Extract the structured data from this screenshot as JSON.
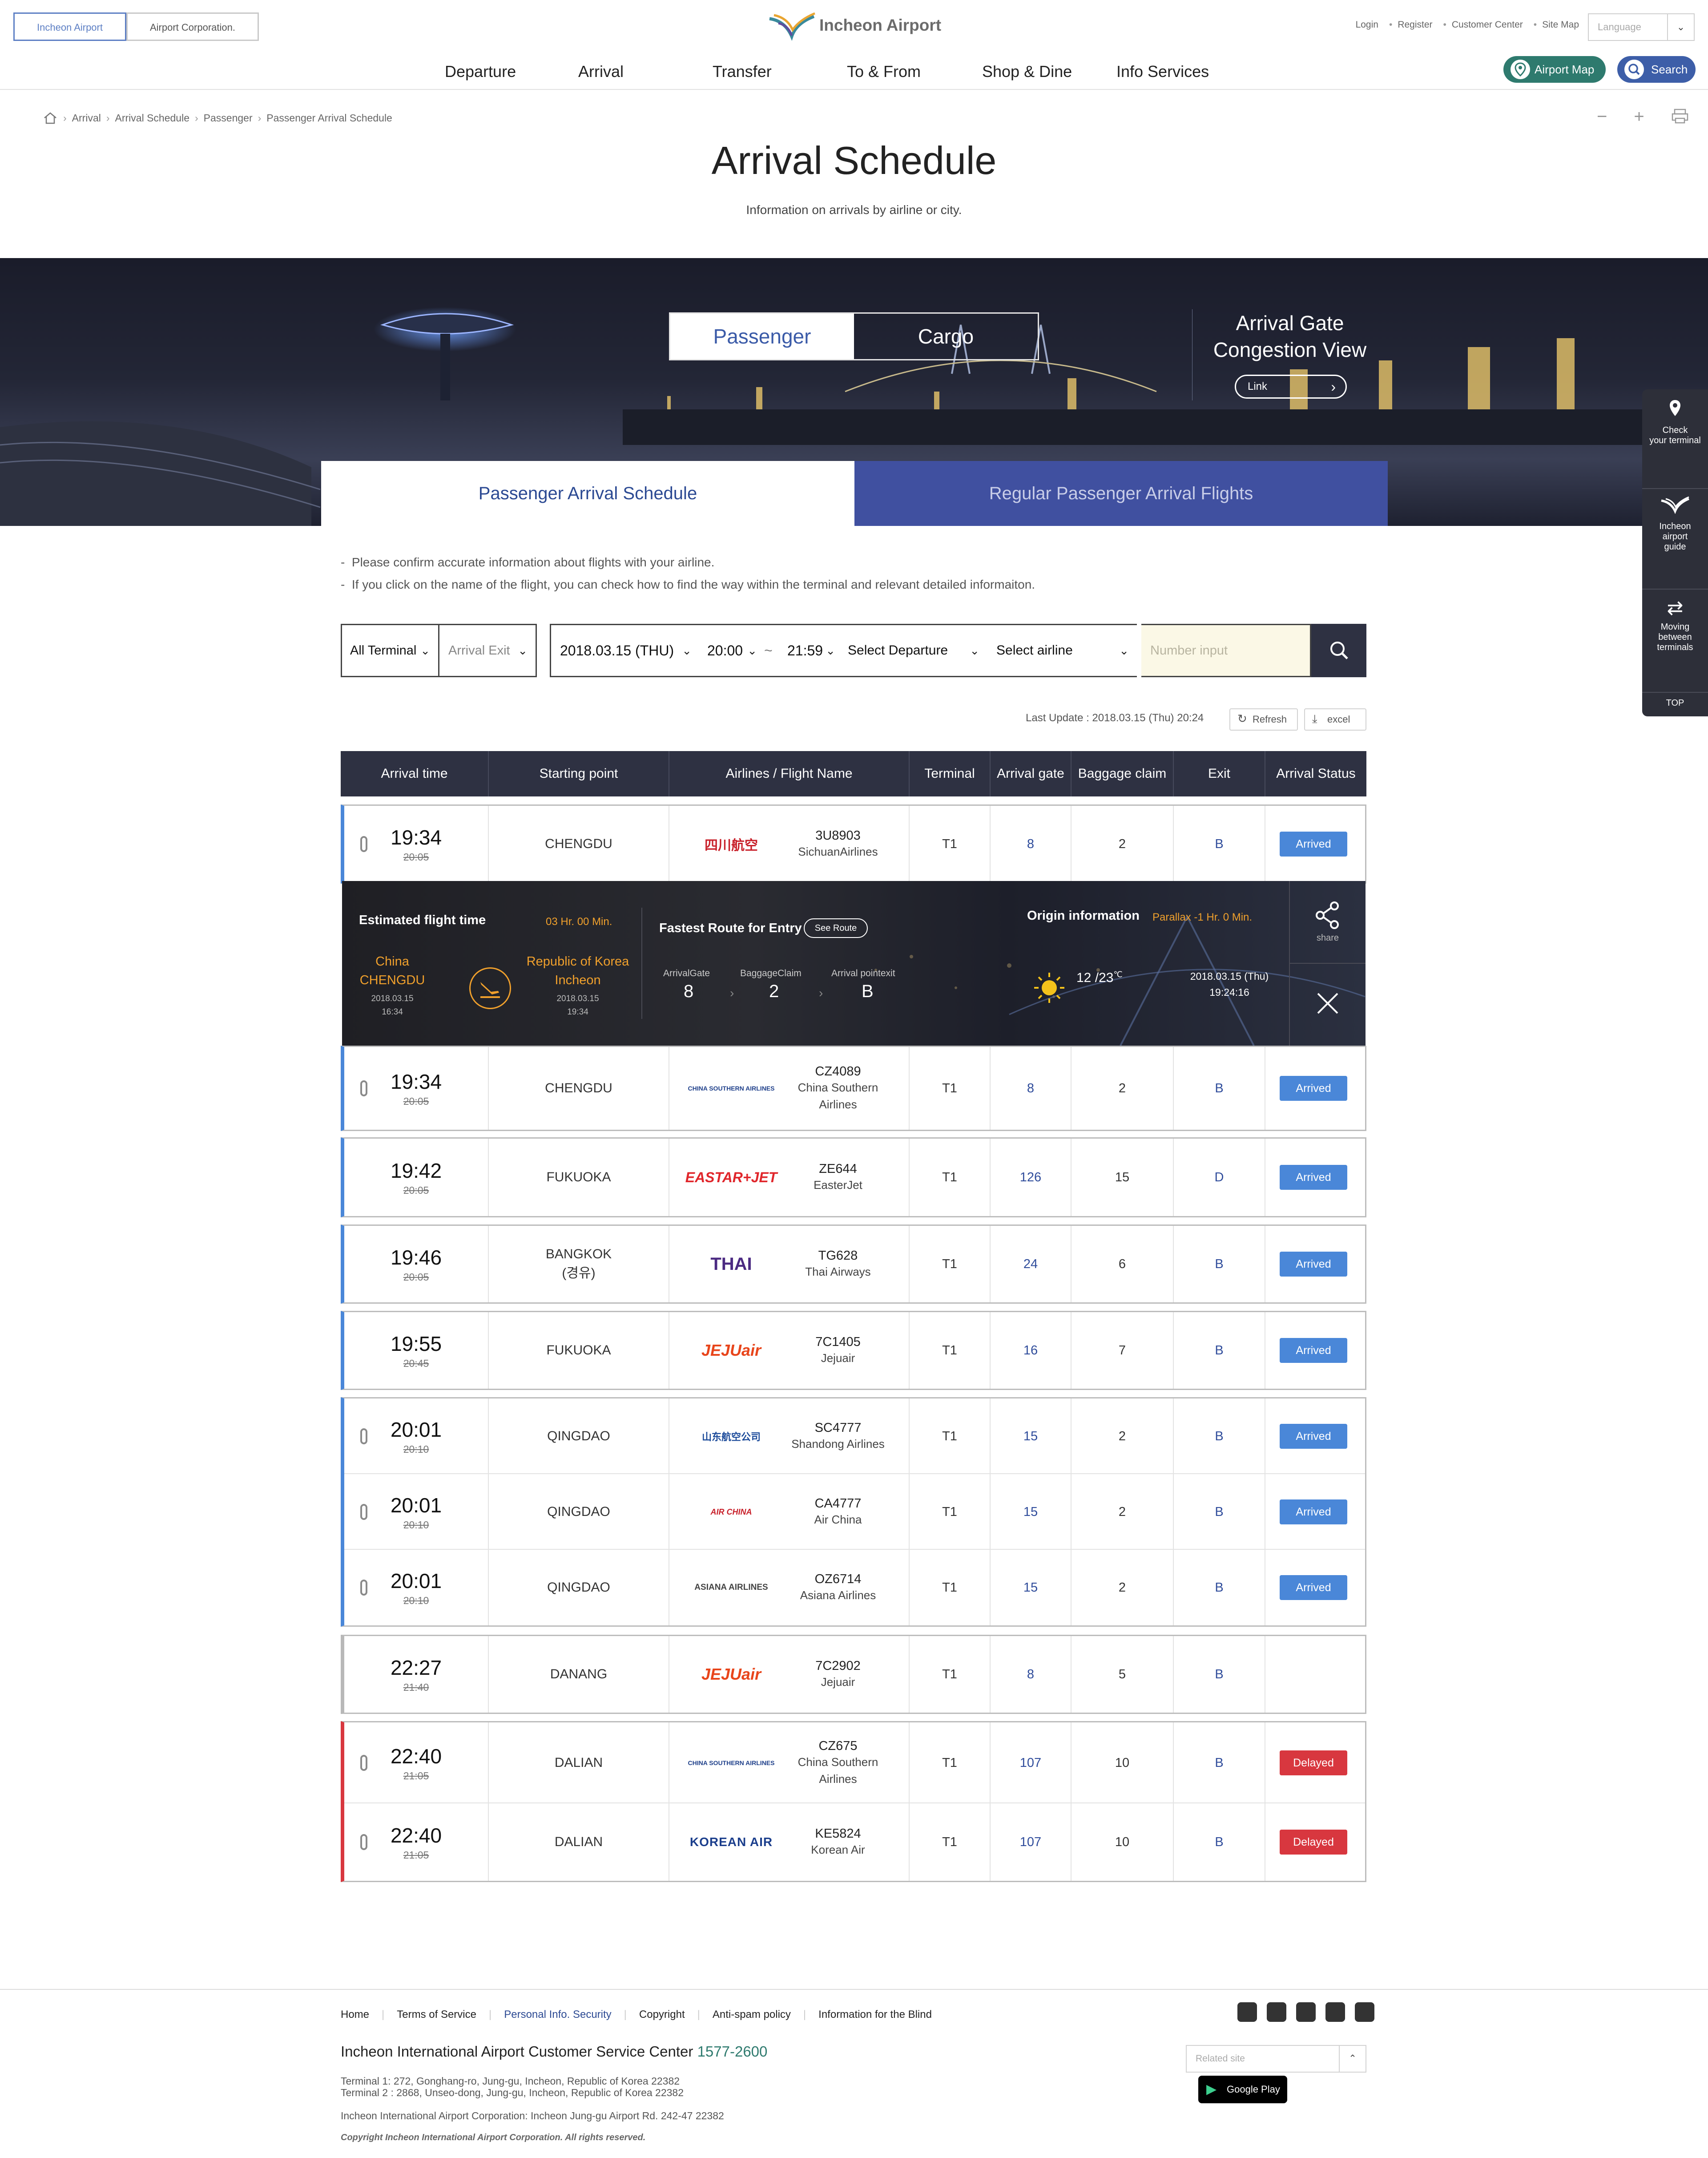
{
  "header": {
    "top_tabs": [
      "Incheon Airport",
      "Airport Corporation."
    ],
    "logo_text": "Incheon Airport",
    "util_links": [
      "Login",
      "Register",
      "Customer Center",
      "Site Map"
    ],
    "language_placeholder": "Language",
    "nav": [
      "Departure",
      "Arrival",
      "Transfer",
      "To & From",
      "Shop & Dine",
      "Info Services"
    ],
    "airport_map": "Airport Map",
    "search": "Search"
  },
  "breadcrumb": [
    "Arrival",
    "Arrival Schedule",
    "Passenger",
    "Passenger Arrival Schedule"
  ],
  "page": {
    "title": "Arrival Schedule",
    "subtitle": "Information on arrivals by airline or city."
  },
  "banner": {
    "switch": [
      "Passenger",
      "Cargo"
    ],
    "congestion_title_1": "Arrival Gate",
    "congestion_title_2": "Congestion View",
    "congestion_link": "Link",
    "subtabs": [
      "Passenger Arrival Schedule",
      "Regular Passenger Arrival Flights"
    ]
  },
  "quick_menu": [
    {
      "line1": "Check",
      "line2": "your terminal",
      "line3": ""
    },
    {
      "line1": "Incheon",
      "line2": "airport",
      "line3": "guide"
    },
    {
      "line1": "Moving",
      "line2": "between",
      "line3": "terminals"
    }
  ],
  "quick_top": "TOP",
  "notes": [
    "Please confirm accurate information about flights with your airline.",
    "If you click on the name of the flight, you can check how to find the way within the terminal and relevant detailed informaiton."
  ],
  "filter": {
    "terminal": "All Terminal",
    "exit": "Arrival Exit",
    "date": "2018.03.15 (THU)",
    "time_from": "20:00",
    "tilde": "~",
    "time_to": "21:59",
    "departure": "Select Departure",
    "airline": "Select airline",
    "number_placeholder": "Number input"
  },
  "update": {
    "text": "Last Update : 2018.03.15 (Thu) 20:24",
    "refresh": "Refresh",
    "excel": "excel"
  },
  "table_headers": [
    "Arrival time",
    "Starting point",
    "Airlines / Flight Name",
    "Terminal",
    "Arrival gate",
    "Baggage claim",
    "Exit",
    "Arrival Status"
  ],
  "rows": [
    {
      "time": "19:34",
      "sched": "20:05",
      "city": "CHENGDU",
      "city2": "",
      "logo": "四川航空",
      "fno": "3U8903",
      "airline": "SichuanAirlines",
      "airline2": "",
      "terminal": "T1",
      "gate": "8",
      "bag": "2",
      "exit": "B",
      "status": "Arrived"
    },
    {
      "time": "19:34",
      "sched": "20:05",
      "city": "CHENGDU",
      "city2": "",
      "logo": "CHINA SOUTHERN AIRLINES",
      "fno": "CZ4089",
      "airline": "China Southern",
      "airline2": "Airlines",
      "terminal": "T1",
      "gate": "8",
      "bag": "2",
      "exit": "B",
      "status": "Arrived"
    },
    {
      "time": "19:42",
      "sched": "20:05",
      "city": "FUKUOKA",
      "city2": "",
      "logo": "EASTAR+JET",
      "fno": "ZE644",
      "airline": "EasterJet",
      "airline2": "",
      "terminal": "T1",
      "gate": "126",
      "bag": "15",
      "exit": "D",
      "status": "Arrived"
    },
    {
      "time": "19:46",
      "sched": "20:05",
      "city": "BANGKOK",
      "city2": "(경유)",
      "logo": "THAI",
      "fno": "TG628",
      "airline": "Thai Airways",
      "airline2": "",
      "terminal": "T1",
      "gate": "24",
      "bag": "6",
      "exit": "B",
      "status": "Arrived"
    },
    {
      "time": "19:55",
      "sched": "20:45",
      "city": "FUKUOKA",
      "city2": "",
      "logo": "JEJUair",
      "fno": "7C1405",
      "airline": "Jejuair",
      "airline2": "",
      "terminal": "T1",
      "gate": "16",
      "bag": "7",
      "exit": "B",
      "status": "Arrived"
    },
    {
      "time": "20:01",
      "sched": "20:10",
      "city": "QINGDAO",
      "city2": "",
      "logo": "山东航空公司",
      "fno": "SC4777",
      "airline": "Shandong Airlines",
      "airline2": "",
      "terminal": "T1",
      "gate": "15",
      "bag": "2",
      "exit": "B",
      "status": "Arrived"
    },
    {
      "time": "20:01",
      "sched": "20:10",
      "city": "QINGDAO",
      "city2": "",
      "logo": "AIR CHINA",
      "fno": "CA4777",
      "airline": "Air China",
      "airline2": "",
      "terminal": "T1",
      "gate": "15",
      "bag": "2",
      "exit": "B",
      "status": "Arrived"
    },
    {
      "time": "20:01",
      "sched": "20:10",
      "city": "QINGDAO",
      "city2": "",
      "logo": "ASIANA AIRLINES",
      "fno": "OZ6714",
      "airline": "Asiana Airlines",
      "airline2": "",
      "terminal": "T1",
      "gate": "15",
      "bag": "2",
      "exit": "B",
      "status": "Arrived"
    },
    {
      "time": "22:27",
      "sched": "21:40",
      "city": "DANANG",
      "city2": "",
      "logo": "JEJUair",
      "fno": "7C2902",
      "airline": "Jejuair",
      "airline2": "",
      "terminal": "T1",
      "gate": "8",
      "bag": "5",
      "exit": "B",
      "status": ""
    },
    {
      "time": "22:40",
      "sched": "21:05",
      "city": "DALIAN",
      "city2": "",
      "logo": "CHINA SOUTHERN AIRLINES",
      "fno": "CZ675",
      "airline": "China Southern",
      "airline2": "Airlines",
      "terminal": "T1",
      "gate": "107",
      "bag": "10",
      "exit": "B",
      "status": "Delayed"
    },
    {
      "time": "22:40",
      "sched": "21:05",
      "city": "DALIAN",
      "city2": "",
      "logo": "KOREAN AIR",
      "fno": "KE5824",
      "airline": "Korean Air",
      "airline2": "",
      "terminal": "T1",
      "gate": "107",
      "bag": "10",
      "exit": "B",
      "status": "Delayed"
    }
  ],
  "detail": {
    "est_label": "Estimated flight time",
    "est_value": "03  Hr.  00  Min.",
    "from_country": "China",
    "from_city": "CHENGDU",
    "from_date": "2018.03.15",
    "from_time": "16:34",
    "to_country": "Republic of Korea",
    "to_city": "Incheon",
    "to_date": "2018.03.15",
    "to_time": "19:34",
    "route_label": "Fastest Route for Entry",
    "see_route": "See Route",
    "gate_label": "ArrivalGate",
    "gate_value": "8",
    "bag_label": "BaggageClaim",
    "bag_value": "2",
    "exit_label": "Arrival pointexit",
    "exit_value": "B",
    "origin_label": "Origin information",
    "parallax": "Parallax  -1  Hr.  0  Min.",
    "temp": "12 /23",
    "temp_unit": "℃",
    "origin_date": "2018.03.15 (Thu)",
    "origin_time": "19:24:16",
    "share": "share"
  },
  "footer": {
    "links": [
      "Home",
      "Terms of Service",
      "Personal Info. Security",
      "Copyright",
      "Anti-spam policy",
      "Information for the Blind"
    ],
    "cc_label": "Incheon International Airport Customer Service Center",
    "cc_phone": "1577-2600",
    "addr1": "Terminal 1: 272, Gonghang-ro, Jung-gu, Incheon, Republic of Korea 22382",
    "addr2": "Terminal 2 : 2868, Unseo-dong, Jung-gu, Incheon, Republic of Korea 22382",
    "addr3": "Incheon International Airport Corporation: Incheon Jung-gu Airport Rd. 242-47 22382",
    "copyright": "Copyright Incheon International Airport Corporation. All rights reserved.",
    "related": "Related site",
    "google_play": "Google Play"
  },
  "colors": {
    "accent": "#3b5ba8",
    "arrived": "#4a87d8",
    "delayed": "#d8373f",
    "header_dark": "#2e3142",
    "orange": "#f0a02c"
  }
}
